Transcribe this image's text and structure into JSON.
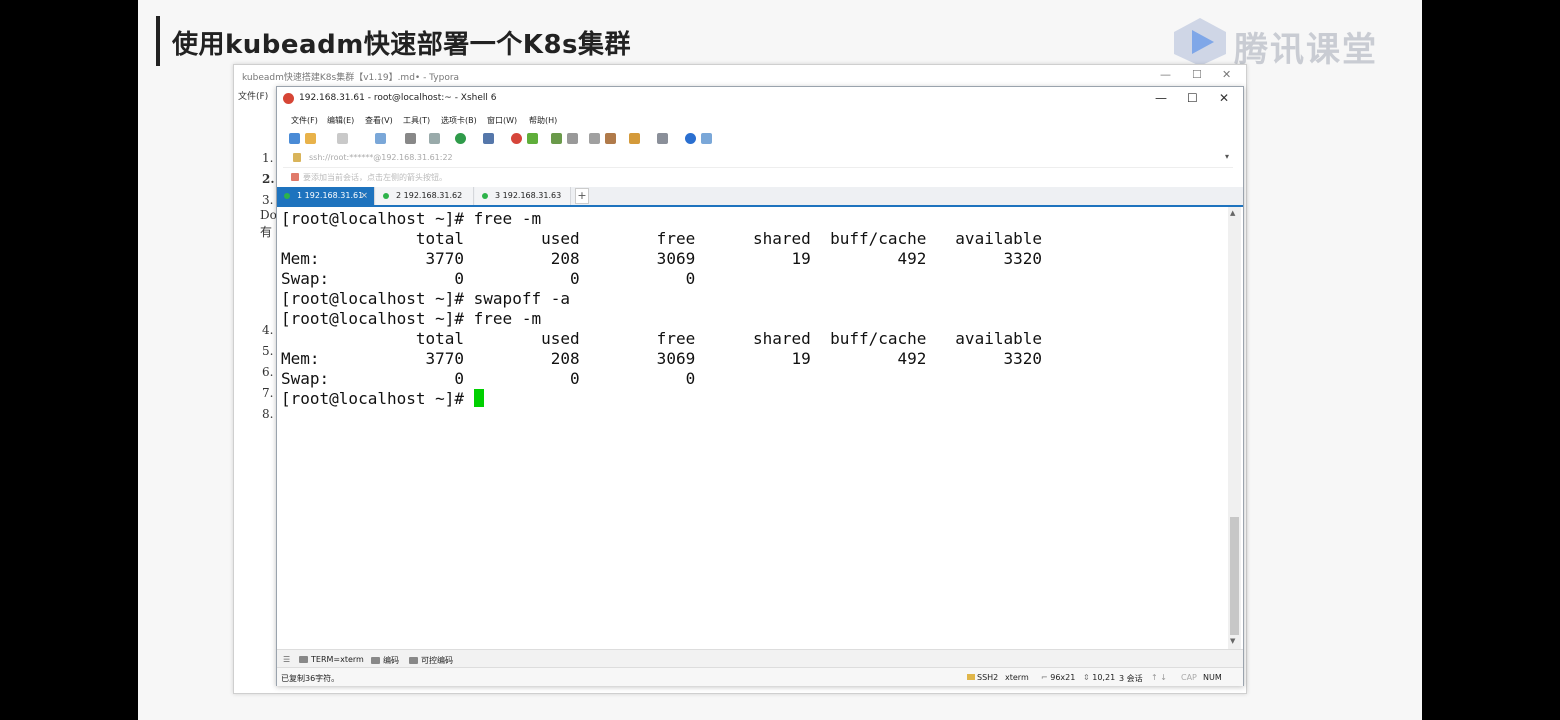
{
  "slide": {
    "title": "使用kubeadm快速部署一个K8s集群",
    "logo_text": "腾讯课堂"
  },
  "typora": {
    "title": "kubeadm快速搭建K8s集群【v1.19】.md• - Typora",
    "menu_file": "文件(F)",
    "outline": [
      "1.",
      "2.",
      "3.",
      "Do",
      "有",
      "4.",
      "5.",
      "6.",
      "7.",
      "8."
    ]
  },
  "xshell": {
    "title": "192.168.31.61 - root@localhost:~ - Xshell 6",
    "menu": [
      "文件(F)",
      "编辑(E)",
      "查看(V)",
      "工具(T)",
      "选项卡(B)",
      "窗口(W)",
      "帮助(H)"
    ],
    "address": "ssh://root:******@192.168.31.61:22",
    "hint": "要添加当前会话，点击左侧的箭头按钮。",
    "tabs": [
      {
        "label": "1 192.168.31.61",
        "active": true
      },
      {
        "label": "2 192.168.31.62",
        "active": false
      },
      {
        "label": "3 192.168.31.63",
        "active": false
      }
    ],
    "tab_add": "+",
    "terminal_lines": [
      "[root@localhost ~]# free -m",
      "              total        used        free      shared  buff/cache   available",
      "Mem:           3770         208        3069          19         492        3320",
      "Swap:             0           0           0",
      "[root@localhost ~]# swapoff -a",
      "[root@localhost ~]# free -m",
      "              total        used        free      shared  buff/cache   available",
      "Mem:           3770         208        3069          19         492        3320",
      "Swap:             0           0           0",
      "[root@localhost ~]# "
    ],
    "compose_bar": {
      "term": "TERM=xterm",
      "encoding": "编码",
      "controllable_encoding": "可控编码"
    },
    "status_bar": {
      "message": "已复制36字符。",
      "protocol": "SSH2",
      "term_type": "xterm",
      "size": "96x21",
      "cursor_pos": "10,21",
      "sessions": "3 会话",
      "cap": "CAP",
      "num": "NUM"
    }
  }
}
